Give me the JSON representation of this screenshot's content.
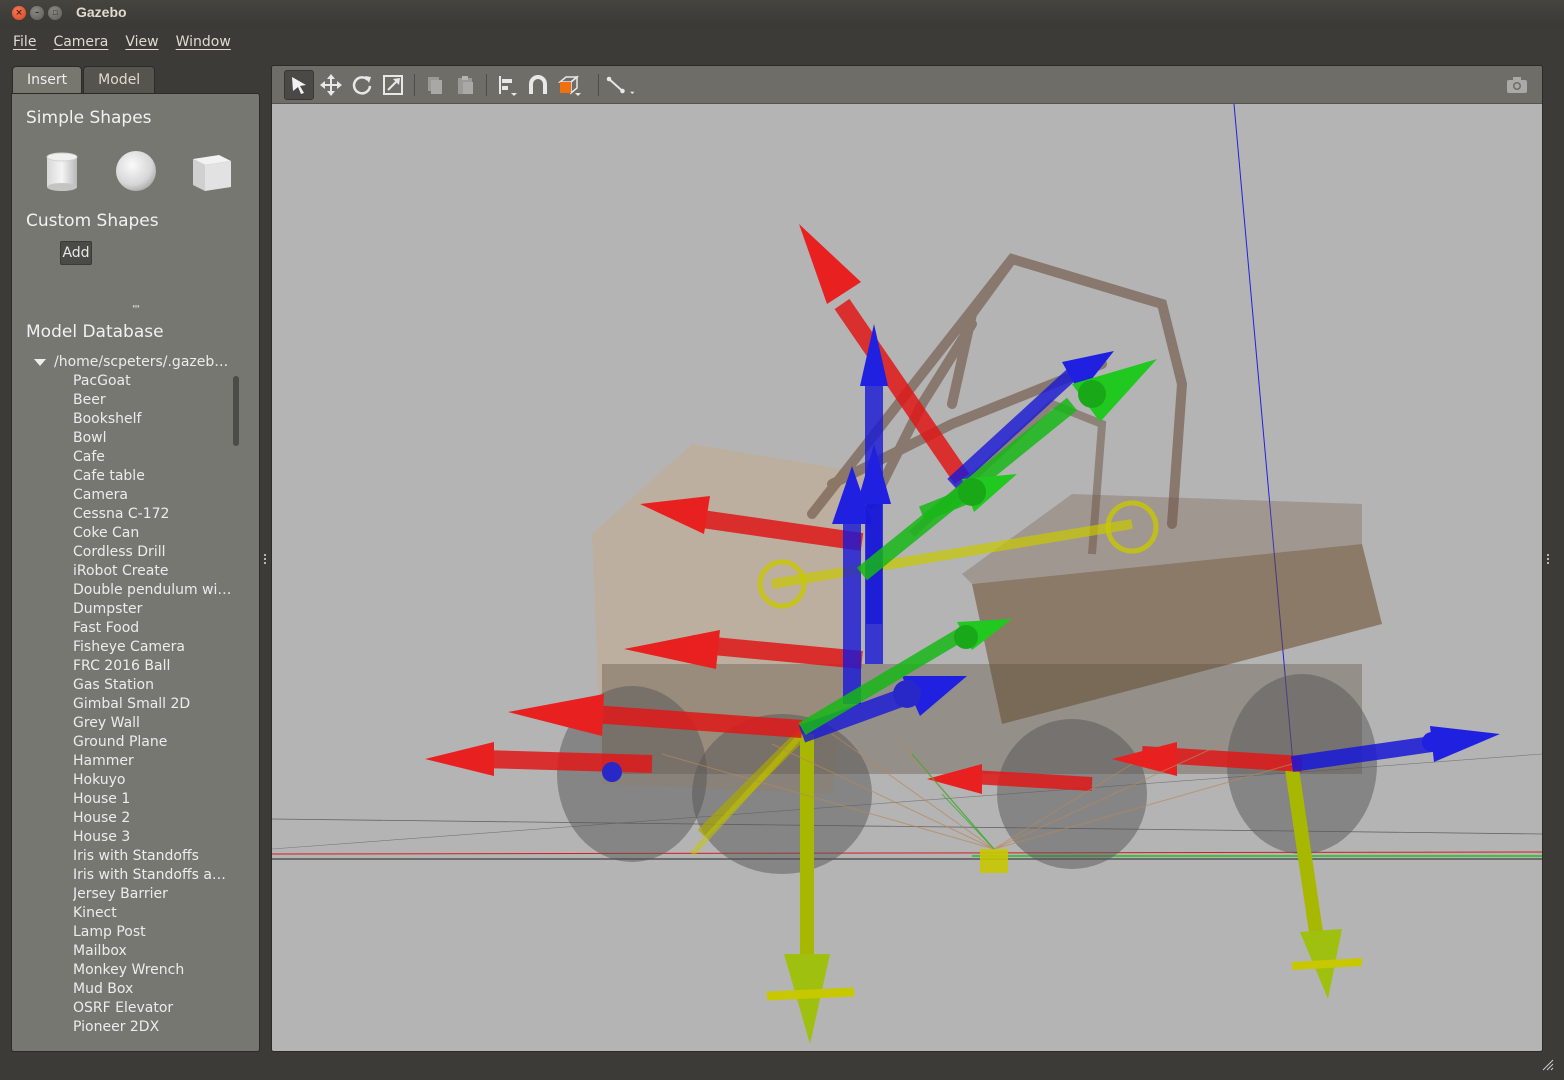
{
  "window": {
    "title": "Gazebo"
  },
  "menu": [
    {
      "label": "File"
    },
    {
      "label": "Camera"
    },
    {
      "label": "View"
    },
    {
      "label": "Window"
    }
  ],
  "tabs": [
    {
      "label": "Insert",
      "active": true
    },
    {
      "label": "Model",
      "active": false
    }
  ],
  "insert": {
    "simple_shapes_title": "Simple Shapes",
    "shapes": [
      "cylinder-icon",
      "sphere-icon",
      "box-icon"
    ],
    "custom_shapes_title": "Custom Shapes",
    "add_label": "Add",
    "model_db_title": "Model Database",
    "tree_root": "/home/scpeters/.gazeb…",
    "models": [
      "PacGoat",
      "Beer",
      "Bookshelf",
      "Bowl",
      "Cafe",
      "Cafe table",
      "Camera",
      "Cessna C-172",
      "Coke Can",
      "Cordless Drill",
      "iRobot Create",
      "Double pendulum wi…",
      "Dumpster",
      "Fast Food",
      "Fisheye Camera",
      "FRC 2016 Ball",
      "Gas Station",
      "Gimbal Small 2D",
      "Grey Wall",
      "Ground Plane",
      "Hammer",
      "Hokuyo",
      "House 1",
      "House 2",
      "House 3",
      "Iris with Standoffs",
      "Iris with Standoffs an…",
      "Jersey Barrier",
      "Kinect",
      "Lamp Post",
      "Mailbox",
      "Monkey Wrench",
      "Mud Box",
      "OSRF Elevator",
      "Pioneer 2DX"
    ]
  },
  "toolbar": {
    "tools": [
      "select-icon",
      "translate-icon",
      "rotate-icon",
      "scale-icon",
      "copy-icon",
      "paste-icon",
      "align-icon",
      "snap-icon",
      "view-angle-icon",
      "joint-icon"
    ],
    "active_tool": "select-icon",
    "right_tool": "screenshot-icon"
  },
  "colors": {
    "background": "#3c3b37",
    "panel": "#777771",
    "scene": "#b4b4b4",
    "x_axis": "#e01818",
    "y_axis": "#18c018",
    "z_axis": "#1818d8",
    "joint_yellow": "#c8c800",
    "accent_orange": "#f07010"
  }
}
